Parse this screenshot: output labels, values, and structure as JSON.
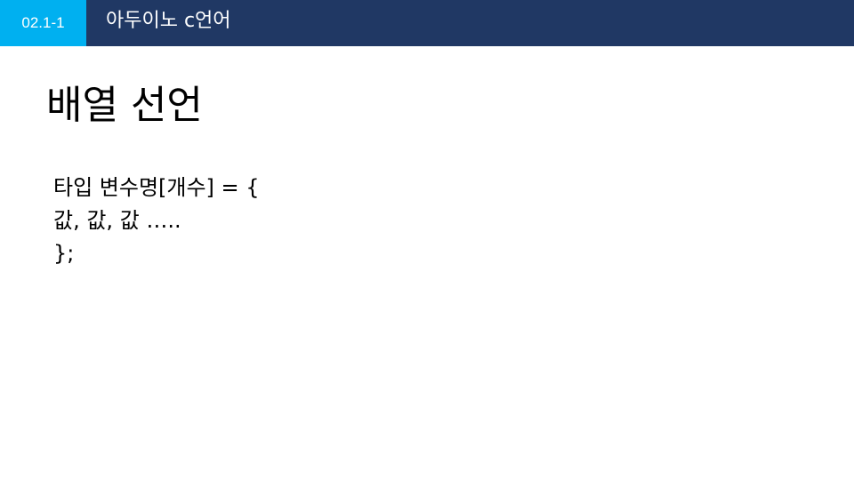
{
  "header": {
    "section_number": "02.1-1",
    "course_title": "아두이노 c언어",
    "colors": {
      "bar": "#203864",
      "badge": "#00b0f0",
      "text": "#ffffff"
    }
  },
  "slide": {
    "title": "배열 선언",
    "code_lines": [
      "타입 변수명[개수] = {",
      "값, 값, 값 …..",
      "};"
    ]
  }
}
